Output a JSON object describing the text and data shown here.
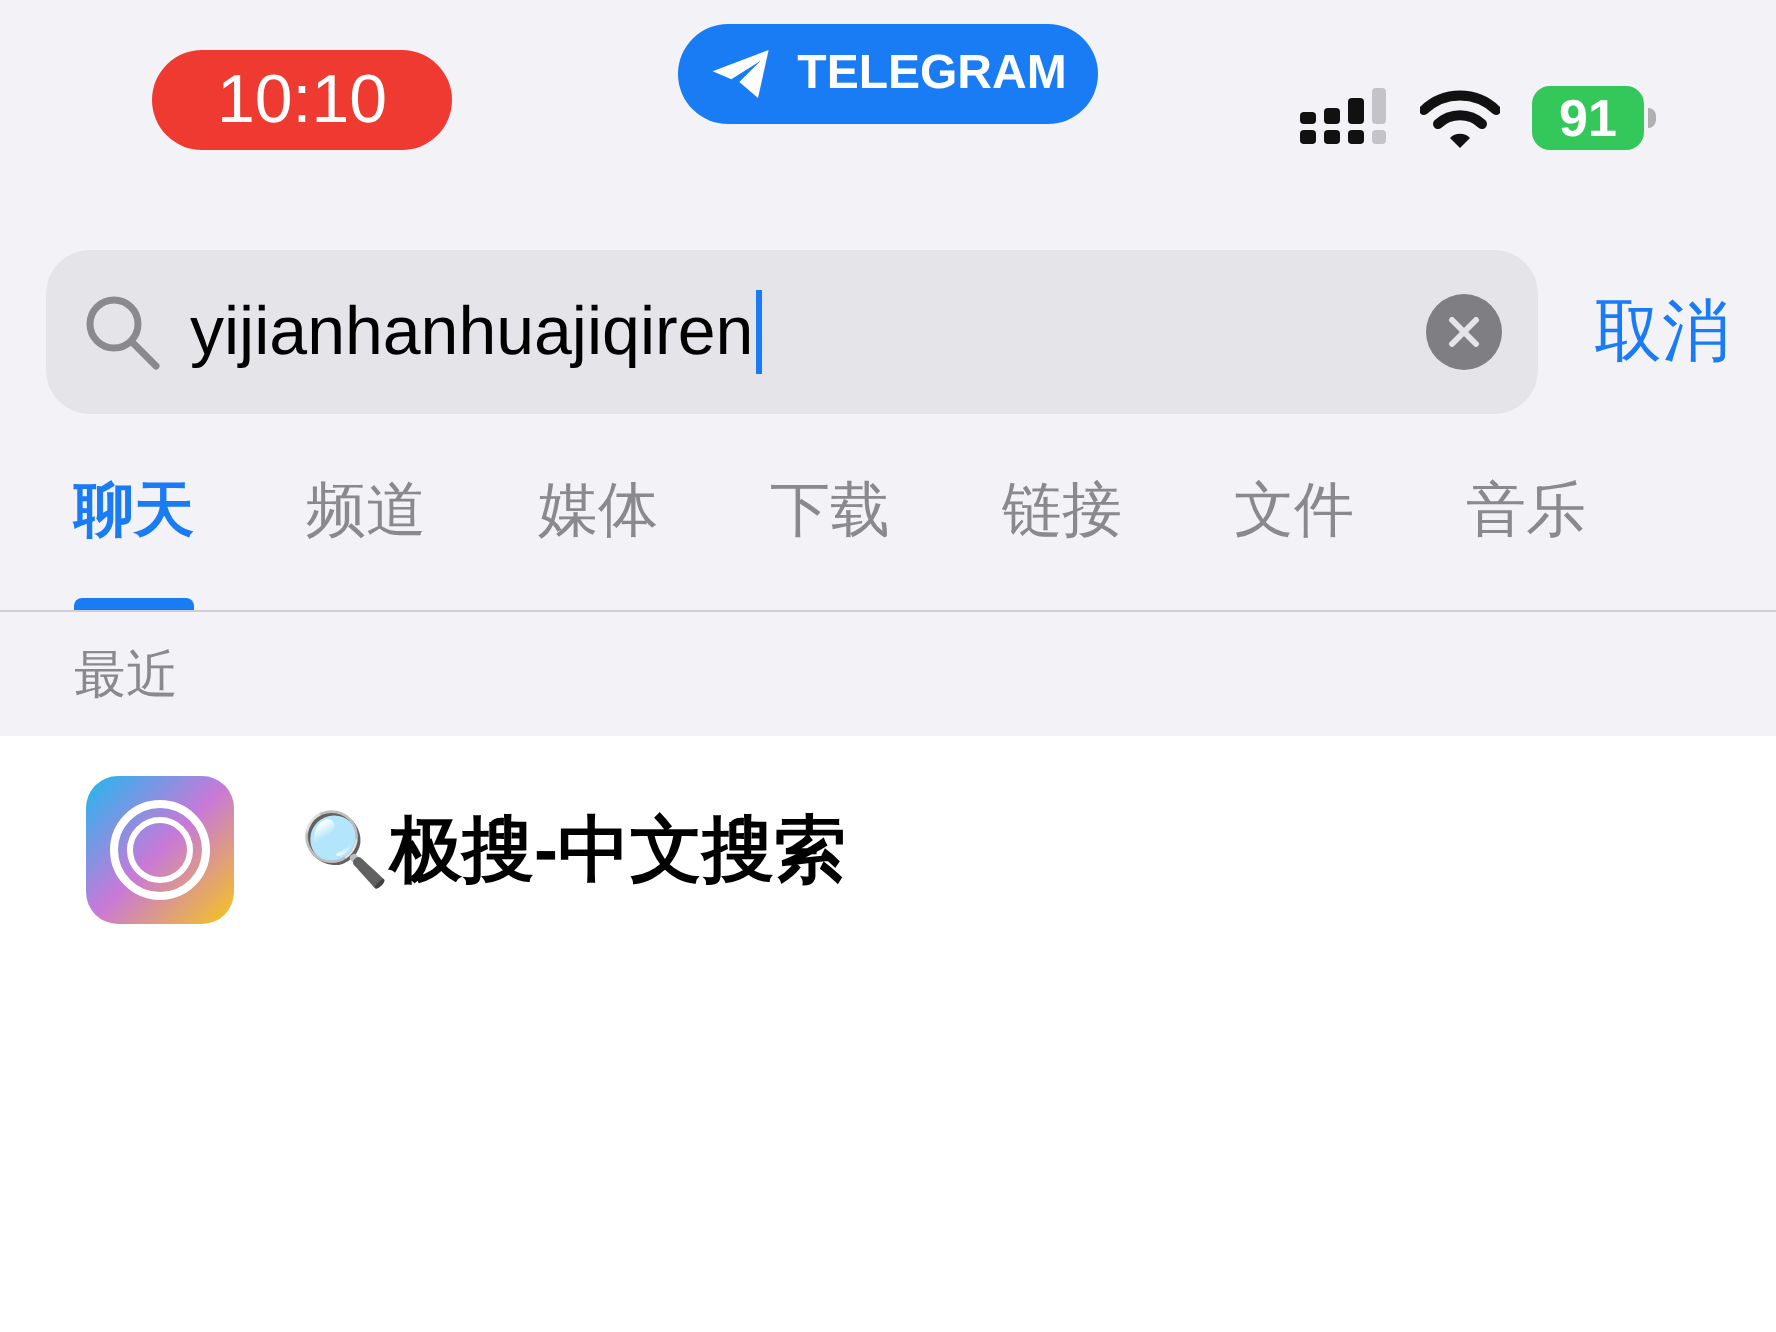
{
  "status_bar": {
    "time": "10:10",
    "app_pill": "TELEGRAM",
    "battery": "91"
  },
  "search": {
    "value": "yijianhanhuajiqiren",
    "cancel": "取消"
  },
  "tabs": [
    {
      "label": "聊天",
      "selected": true
    },
    {
      "label": "频道",
      "selected": false
    },
    {
      "label": "媒体",
      "selected": false
    },
    {
      "label": "下载",
      "selected": false
    },
    {
      "label": "链接",
      "selected": false
    },
    {
      "label": "文件",
      "selected": false
    },
    {
      "label": "音乐",
      "selected": false
    }
  ],
  "section_header": "最近",
  "results": [
    {
      "title": "🔍极搜-中文搜索"
    }
  ]
}
